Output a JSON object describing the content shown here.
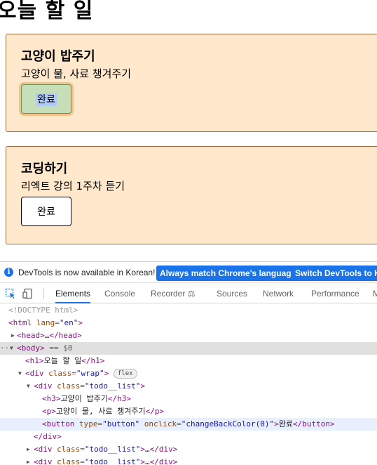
{
  "page": {
    "title": "오늘 할 일",
    "todos": [
      {
        "title": "고양이 밥주기",
        "desc": "고양이 물, 사료 챙겨주기",
        "button": "완료"
      },
      {
        "title": "코딩하기",
        "desc": "리엑트 강의 1주차 듣기",
        "button": "완료"
      }
    ]
  },
  "devtools": {
    "info_text": "DevTools is now available in Korean!",
    "info_button_1": "Always match Chrome's language",
    "info_button_2": "Switch DevTools to Ko",
    "tabs": [
      "Elements",
      "Console",
      "Recorder",
      "Sources",
      "Network",
      "Performance",
      "M"
    ],
    "active_tab": "Elements",
    "dom": {
      "doctype": "<!DOCTYPE html>",
      "html_open": "html",
      "html_lang_attr": "lang",
      "html_lang_val": "\"en\"",
      "head": "head",
      "body": "body",
      "body_eq": " == $0",
      "h1_text": "오늘 할 일",
      "wrap_class": "\"wrap\"",
      "flex_badge": "flex",
      "todo_class": "\"todo__list\"",
      "h3_text": "고양이 밥주기",
      "p_text": "고양이 물, 사료 챙겨주기",
      "btn_type": "\"button\"",
      "btn_onclick": "\"changeBackColor(0)\"",
      "btn_text": "완료"
    }
  },
  "colors": {
    "card_bg": "#ffe8cc",
    "card_border": "#9b6a3a",
    "done_button_bg": "#c6dfb8",
    "devtools_accent": "#1a73e8"
  }
}
